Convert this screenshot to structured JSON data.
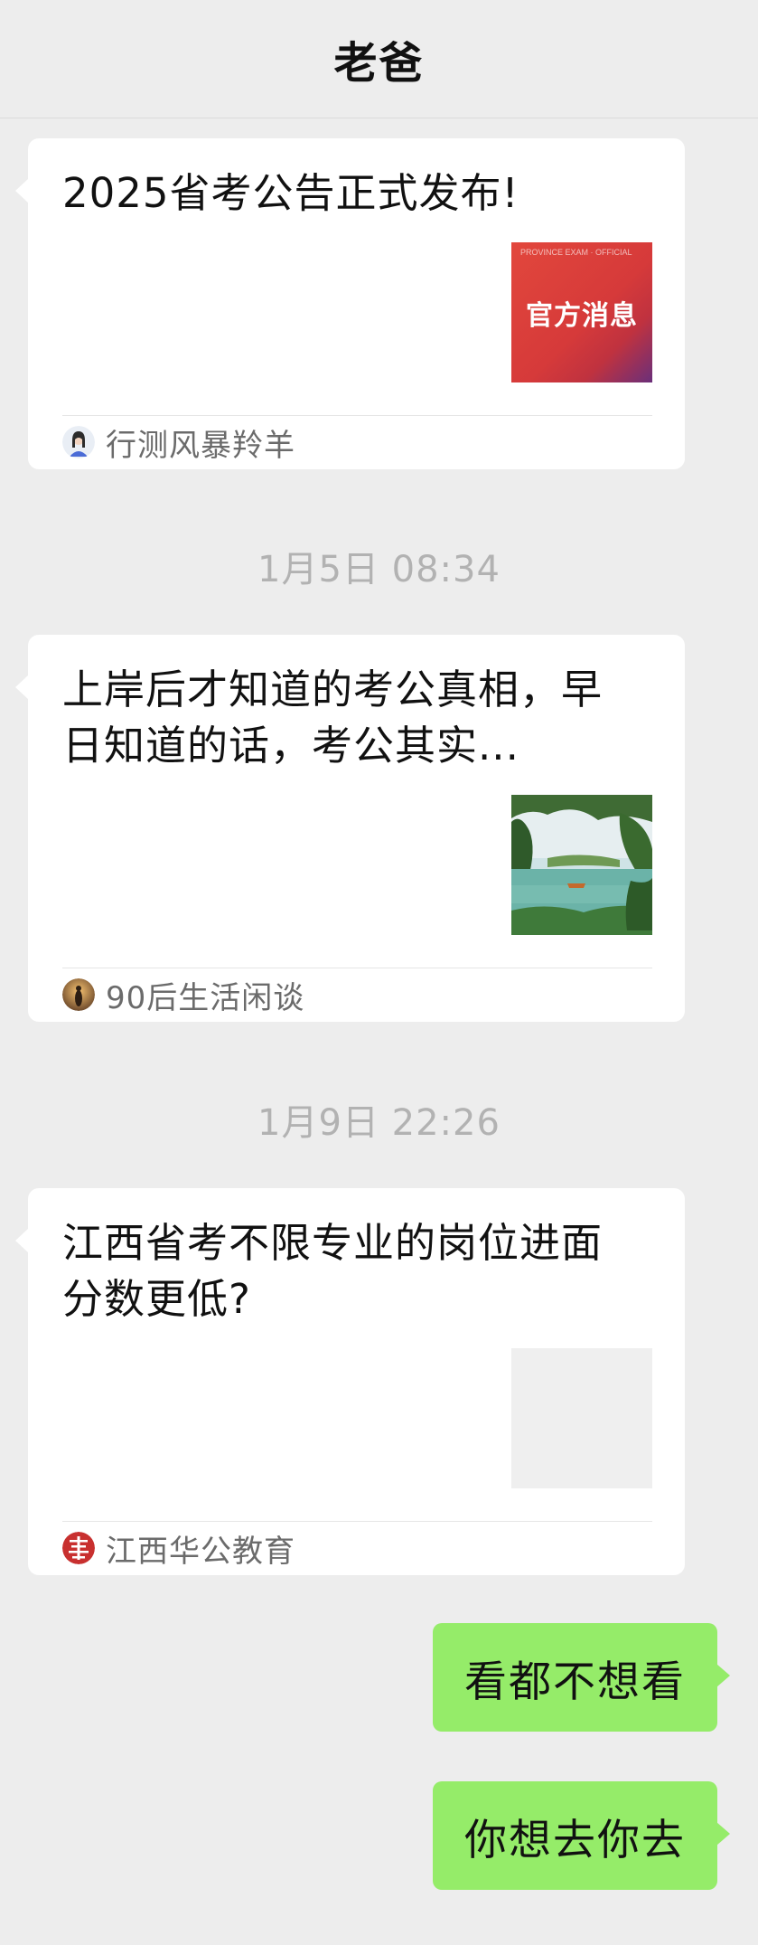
{
  "header": {
    "title": "老爸"
  },
  "messages": [
    {
      "type": "article",
      "title": "2025省考公告正式发布!",
      "thumbnail": {
        "kind": "official-graphic",
        "small_text": "PROVINCE EXAM · OFFICIAL",
        "main_text": "官方消息"
      },
      "source": {
        "name": "行测风暴羚羊",
        "avatar": "woman-portrait-avatar"
      }
    },
    {
      "type": "timestamp",
      "text": "1月5日 08:34"
    },
    {
      "type": "article",
      "title": "上岸后才知道的考公真相，早日知道的话，考公其实...",
      "thumbnail": {
        "kind": "lake-landscape-photo"
      },
      "source": {
        "name": "90后生活闲谈",
        "avatar": "sunset-portrait-avatar"
      }
    },
    {
      "type": "timestamp",
      "text": "1月9日 22:26"
    },
    {
      "type": "article",
      "title": "江西省考不限专业的岗位进面分数更低?",
      "thumbnail": {
        "kind": "blank-image"
      },
      "source": {
        "name": "江西华公教育",
        "avatar": "huagong-logo-avatar"
      }
    },
    {
      "type": "sent-text",
      "text": "看都不想看"
    },
    {
      "type": "sent-text",
      "text": "你想去你去"
    }
  ],
  "colors": {
    "background": "#ededed",
    "card": "#ffffff",
    "sent_bubble": "#95ec69",
    "timestamp": "#b2b2b2",
    "source_text": "#6b6b6b",
    "official_red": "#d63a3a"
  }
}
